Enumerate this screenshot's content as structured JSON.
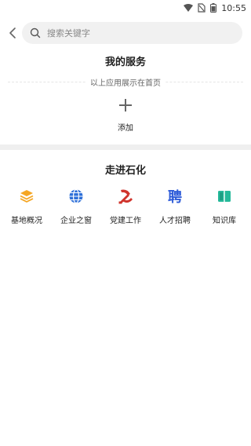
{
  "status_bar": {
    "time": "10:55"
  },
  "search": {
    "placeholder": "搜索关键字"
  },
  "my_services": {
    "title": "我的服务",
    "hint": "以上应用展示在首页",
    "add_label": "添加"
  },
  "petrochem": {
    "title": "走进石化",
    "items": [
      {
        "label": "基地概况",
        "icon": "layers-icon",
        "color": "#f5a623"
      },
      {
        "label": "企业之窗",
        "icon": "globe-icon",
        "color": "#2d6fd8"
      },
      {
        "label": "党建工作",
        "icon": "party-emblem-icon",
        "color": "#d0342c"
      },
      {
        "label": "人才招聘",
        "icon": "recruit-char-icon",
        "color": "#2d5bd8"
      },
      {
        "label": "知识库",
        "icon": "book-icon",
        "color": "#25b99a"
      }
    ],
    "recruit_glyph": "聘"
  }
}
